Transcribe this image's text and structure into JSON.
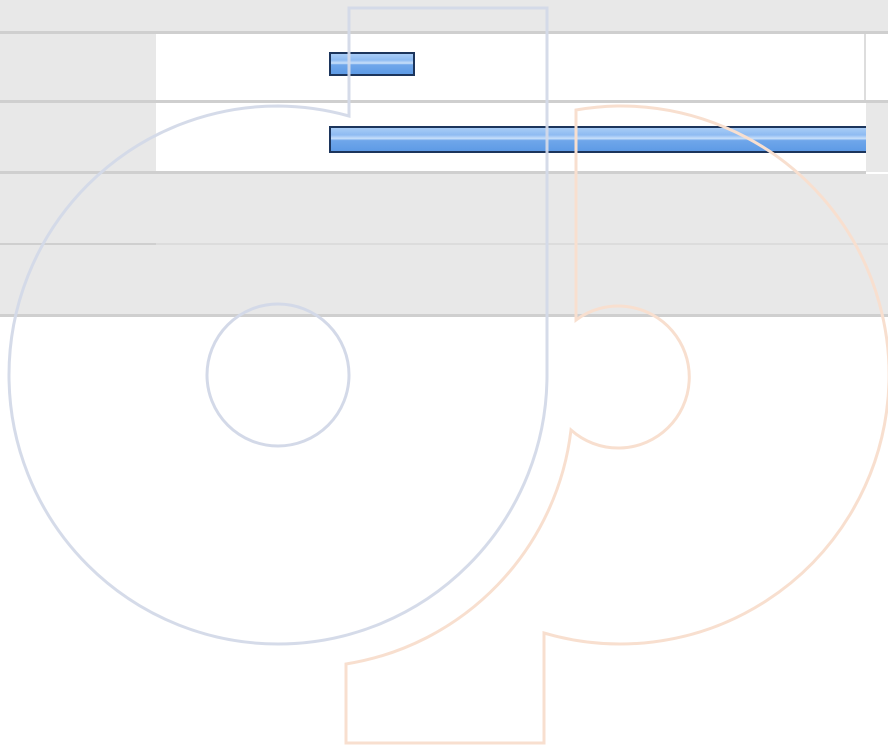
{
  "window": {
    "title": ""
  },
  "watermark": {
    "icon": "disc-watermark-icon",
    "left_disc_color": "#d3d9e8",
    "right_disc_color": "#f8dfcf"
  },
  "colors": {
    "panel_background": "#e8e8e8",
    "row_background": "#ffffff",
    "rule": "#cfcfcf",
    "bar_border": "#1c355c",
    "bar_fill": "#6fa6ea"
  },
  "rows": [
    {
      "label": "",
      "progress": 0.144
    },
    {
      "label": "",
      "progress": 1.0
    },
    {
      "label": ""
    },
    {
      "label": ""
    }
  ]
}
